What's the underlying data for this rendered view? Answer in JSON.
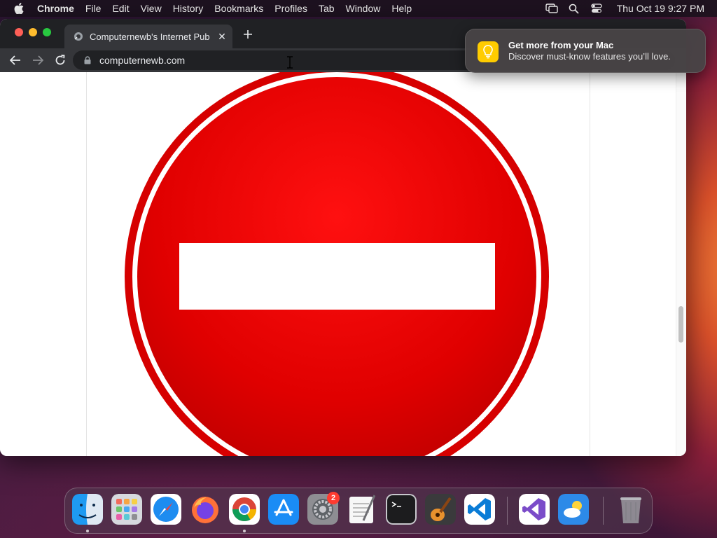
{
  "menubar": {
    "app_name": "Chrome",
    "items": [
      "File",
      "Edit",
      "View",
      "History",
      "Bookmarks",
      "Profiles",
      "Tab",
      "Window",
      "Help"
    ],
    "clock": "Thu Oct 19  9:27 PM",
    "icons": [
      "screen-mirroring-icon",
      "spotlight-search-icon",
      "control-center-icon"
    ]
  },
  "browser": {
    "tab": {
      "title": "Computernewb's Internet Pub",
      "favicon": "computernewb-favicon"
    },
    "url": "computernewb.com",
    "theme": {
      "tabstrip": "#202124",
      "toolbar": "#35363a",
      "text": "#e8eaed"
    }
  },
  "page": {
    "image": "no-entry-sign",
    "sign_colors": {
      "red": "#e00000",
      "white": "#ffffff"
    }
  },
  "notification": {
    "title": "Get more from your Mac",
    "body": "Discover must-know features you’ll love.",
    "icon": "lightbulb-icon",
    "icon_color": "#ffcc00"
  },
  "dock": {
    "apps": [
      {
        "name": "Finder",
        "running": true
      },
      {
        "name": "Launchpad",
        "running": false
      },
      {
        "name": "Safari",
        "running": false
      },
      {
        "name": "Firefox",
        "running": false
      },
      {
        "name": "Google Chrome",
        "running": true
      },
      {
        "name": "App Store",
        "running": false
      },
      {
        "name": "System Settings",
        "running": false,
        "badge": "2"
      },
      {
        "name": "TextEdit",
        "running": false
      },
      {
        "name": "Terminal",
        "running": false
      },
      {
        "name": "GarageBand",
        "running": false
      },
      {
        "name": "Visual Studio Code",
        "running": false
      },
      {
        "name": "Visual Studio",
        "running": false
      },
      {
        "name": "Weather",
        "running": false
      },
      {
        "name": "Trash",
        "running": false
      }
    ]
  }
}
